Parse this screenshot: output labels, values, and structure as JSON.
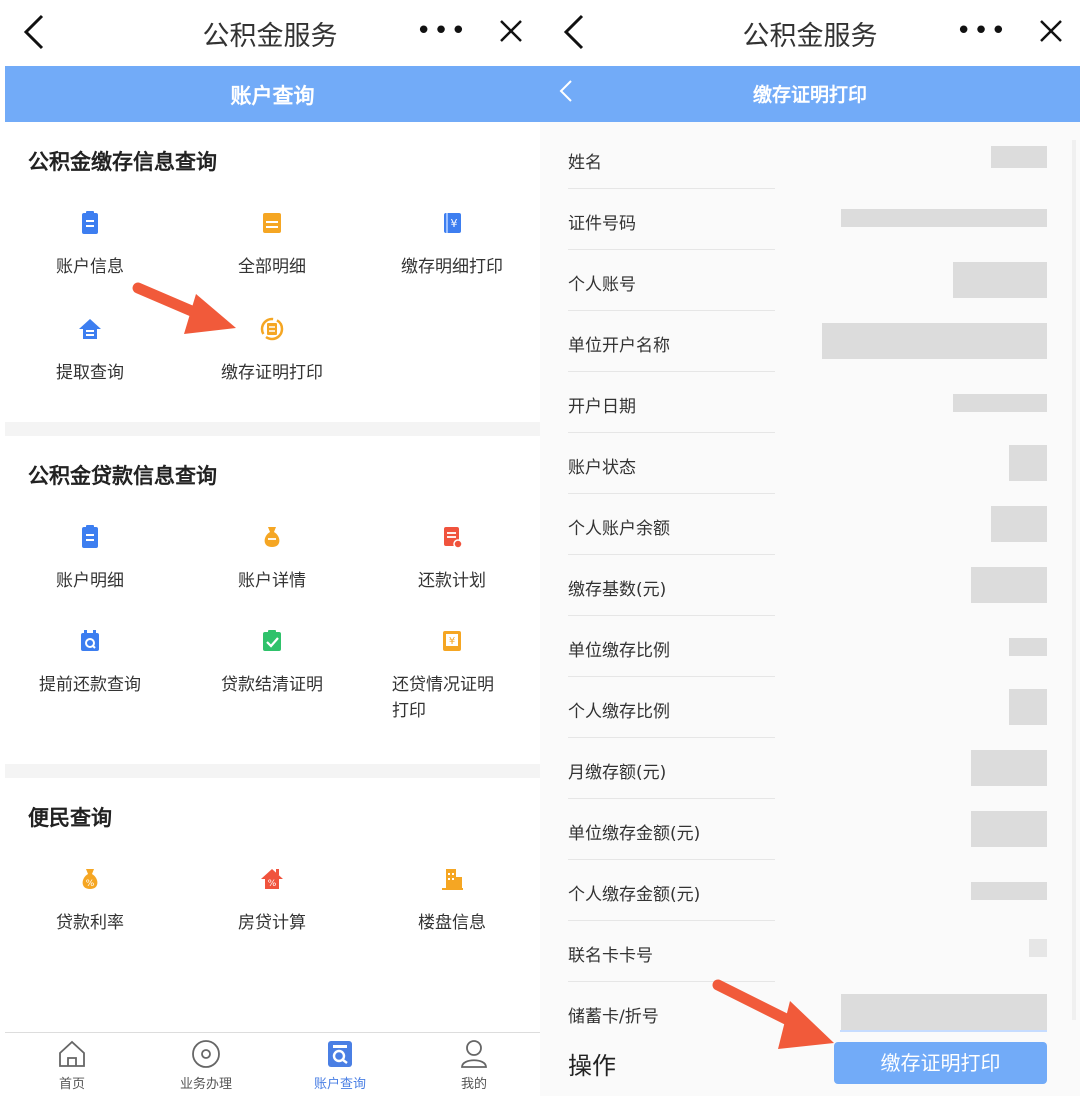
{
  "left": {
    "appbar": {
      "title": "公积金服务",
      "more": "•••"
    },
    "header": {
      "title": "账户查询"
    },
    "sections": [
      {
        "title": "公积金缴存信息查询",
        "items": [
          {
            "label": "账户信息",
            "icon": "clipboard-icon",
            "color": "#3d7ef0"
          },
          {
            "label": "全部明细",
            "icon": "list-card-icon",
            "color": "#f5a623"
          },
          {
            "label": "缴存明细打印",
            "icon": "yuan-book-icon",
            "color": "#3d7ef0"
          },
          {
            "label": "提取查询",
            "icon": "house-arrow-icon",
            "color": "#3d7ef0"
          },
          {
            "label": "缴存证明打印",
            "icon": "certificate-cycle-icon",
            "color": "#f5a623"
          }
        ]
      },
      {
        "title": "公积金贷款信息查询",
        "items": [
          {
            "label": "账户明细",
            "icon": "clipboard-icon",
            "color": "#3d7ef0"
          },
          {
            "label": "账户详情",
            "icon": "money-bag-icon",
            "color": "#f5a623"
          },
          {
            "label": "还款计划",
            "icon": "plan-sheet-icon",
            "color": "#f0533d"
          },
          {
            "label": "提前还款查询",
            "icon": "calendar-search-icon",
            "color": "#3d7ef0"
          },
          {
            "label": "贷款结清证明",
            "icon": "check-clipboard-icon",
            "color": "#2fc26b"
          },
          {
            "label": "还贷情况证明打印",
            "icon": "yuan-scroll-icon",
            "color": "#f5a623"
          }
        ]
      },
      {
        "title": "便民查询",
        "items": [
          {
            "label": "贷款利率",
            "icon": "percent-bag-icon",
            "color": "#f5a623"
          },
          {
            "label": "房贷计算",
            "icon": "house-percent-icon",
            "color": "#f0533d"
          },
          {
            "label": "楼盘信息",
            "icon": "building-icon",
            "color": "#f5a623"
          }
        ]
      }
    ],
    "tabs": [
      {
        "label": "首页",
        "icon": "home-icon"
      },
      {
        "label": "业务办理",
        "icon": "circle-target-icon"
      },
      {
        "label": "账户查询",
        "icon": "account-search-icon"
      },
      {
        "label": "我的",
        "icon": "person-icon"
      }
    ]
  },
  "right": {
    "appbar": {
      "title": "公积金服务",
      "more": "•••"
    },
    "header": {
      "title": "缴存证明打印"
    },
    "fields": [
      {
        "label": "姓名"
      },
      {
        "label": "证件号码"
      },
      {
        "label": "个人账号"
      },
      {
        "label": "单位开户名称"
      },
      {
        "label": "开户日期"
      },
      {
        "label": "账户状态"
      },
      {
        "label": "个人账户余额"
      },
      {
        "label": "缴存基数(元)"
      },
      {
        "label": "单位缴存比例"
      },
      {
        "label": "个人缴存比例"
      },
      {
        "label": "月缴存额(元)"
      },
      {
        "label": "单位缴存金额(元)"
      },
      {
        "label": "个人缴存金额(元)"
      },
      {
        "label": "联名卡卡号"
      },
      {
        "label": "储蓄卡/折号"
      }
    ],
    "operation_label": "操作",
    "print_button": "缴存证明打印"
  },
  "colors": {
    "header_blue": "#72abf8",
    "arrow_red": "#f15a3a",
    "active_tab": "#4a7fe4"
  }
}
